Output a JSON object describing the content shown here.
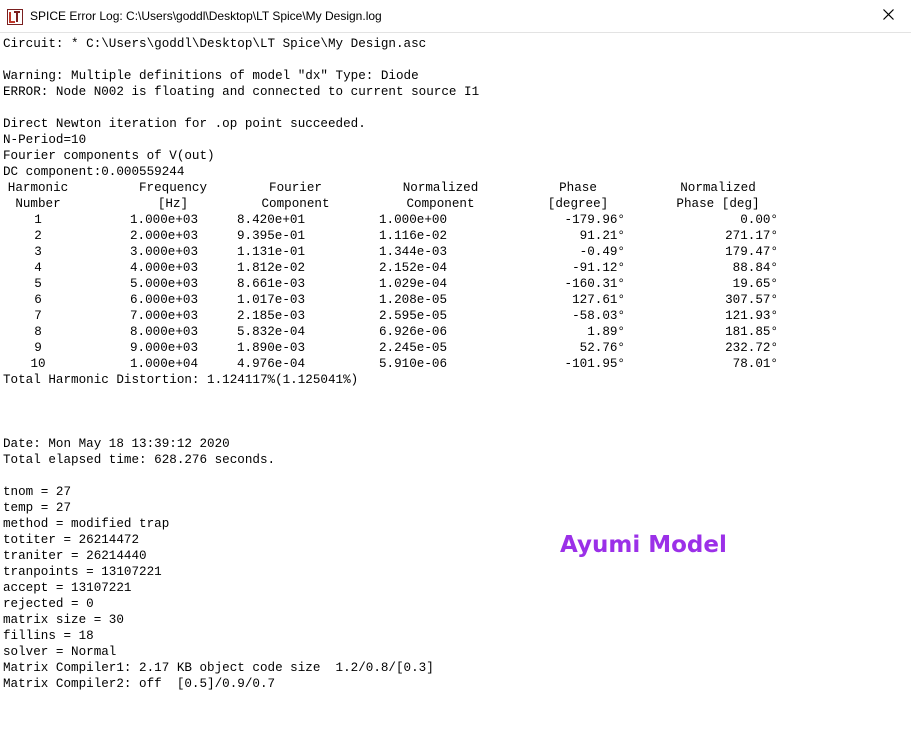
{
  "window": {
    "title": "SPICE Error Log: C:\\Users\\goddl\\Desktop\\LT Spice\\My Design.log",
    "app_icon": "ltspice-logo-icon",
    "close_icon": "close-icon"
  },
  "log_header": [
    "Circuit: * C:\\Users\\goddl\\Desktop\\LT Spice\\My Design.asc",
    "",
    "Warning: Multiple definitions of model \"dx\" Type: Diode",
    "ERROR: Node N002 is floating and connected to current source I1",
    "",
    "Direct Newton iteration for .op point succeeded.",
    "N-Period=10",
    "Fourier components of V(out)",
    "DC component:0.000559244"
  ],
  "fourier_table": {
    "headers_line1": [
      "Harmonic",
      "Frequency",
      "Fourier",
      "Normalized",
      "Phase",
      "Normalized"
    ],
    "headers_line2": [
      "Number",
      "[Hz]",
      "Component",
      "Component",
      "[degree]",
      "Phase [deg]"
    ],
    "rows": [
      [
        "1",
        "1.000e+03",
        "8.420e+01",
        "1.000e+00",
        "-179.96°",
        "0.00°"
      ],
      [
        "2",
        "2.000e+03",
        "9.395e-01",
        "1.116e-02",
        "91.21°",
        "271.17°"
      ],
      [
        "3",
        "3.000e+03",
        "1.131e-01",
        "1.344e-03",
        "-0.49°",
        "179.47°"
      ],
      [
        "4",
        "4.000e+03",
        "1.812e-02",
        "2.152e-04",
        "-91.12°",
        "88.84°"
      ],
      [
        "5",
        "5.000e+03",
        "8.661e-03",
        "1.029e-04",
        "-160.31°",
        "19.65°"
      ],
      [
        "6",
        "6.000e+03",
        "1.017e-03",
        "1.208e-05",
        "127.61°",
        "307.57°"
      ],
      [
        "7",
        "7.000e+03",
        "2.185e-03",
        "2.595e-05",
        "-58.03°",
        "121.93°"
      ],
      [
        "8",
        "8.000e+03",
        "5.832e-04",
        "6.926e-06",
        "1.89°",
        "181.85°"
      ],
      [
        "9",
        "9.000e+03",
        "1.890e-03",
        "2.245e-05",
        "52.76°",
        "232.72°"
      ],
      [
        "10",
        "1.000e+04",
        "4.976e-04",
        "5.910e-06",
        "-101.95°",
        "78.01°"
      ]
    ],
    "thd": "Total Harmonic Distortion: 1.124117%(1.125041%)"
  },
  "log_footer": [
    "",
    "",
    "",
    "Date: Mon May 18 13:39:12 2020",
    "Total elapsed time: 628.276 seconds.",
    "",
    "tnom = 27",
    "temp = 27",
    "method = modified trap",
    "totiter = 26214472",
    "traniter = 26214440",
    "tranpoints = 13107221",
    "accept = 13107221",
    "rejected = 0",
    "matrix size = 30",
    "fillins = 18",
    "solver = Normal",
    "Matrix Compiler1: 2.17 KB object code size  1.2/0.8/[0.3]",
    "Matrix Compiler2: off  [0.5]/0.9/0.7"
  ],
  "watermark": "Ayumi Model",
  "colors": {
    "watermark": "#9b30e8",
    "icon_red": "#c0392b"
  }
}
